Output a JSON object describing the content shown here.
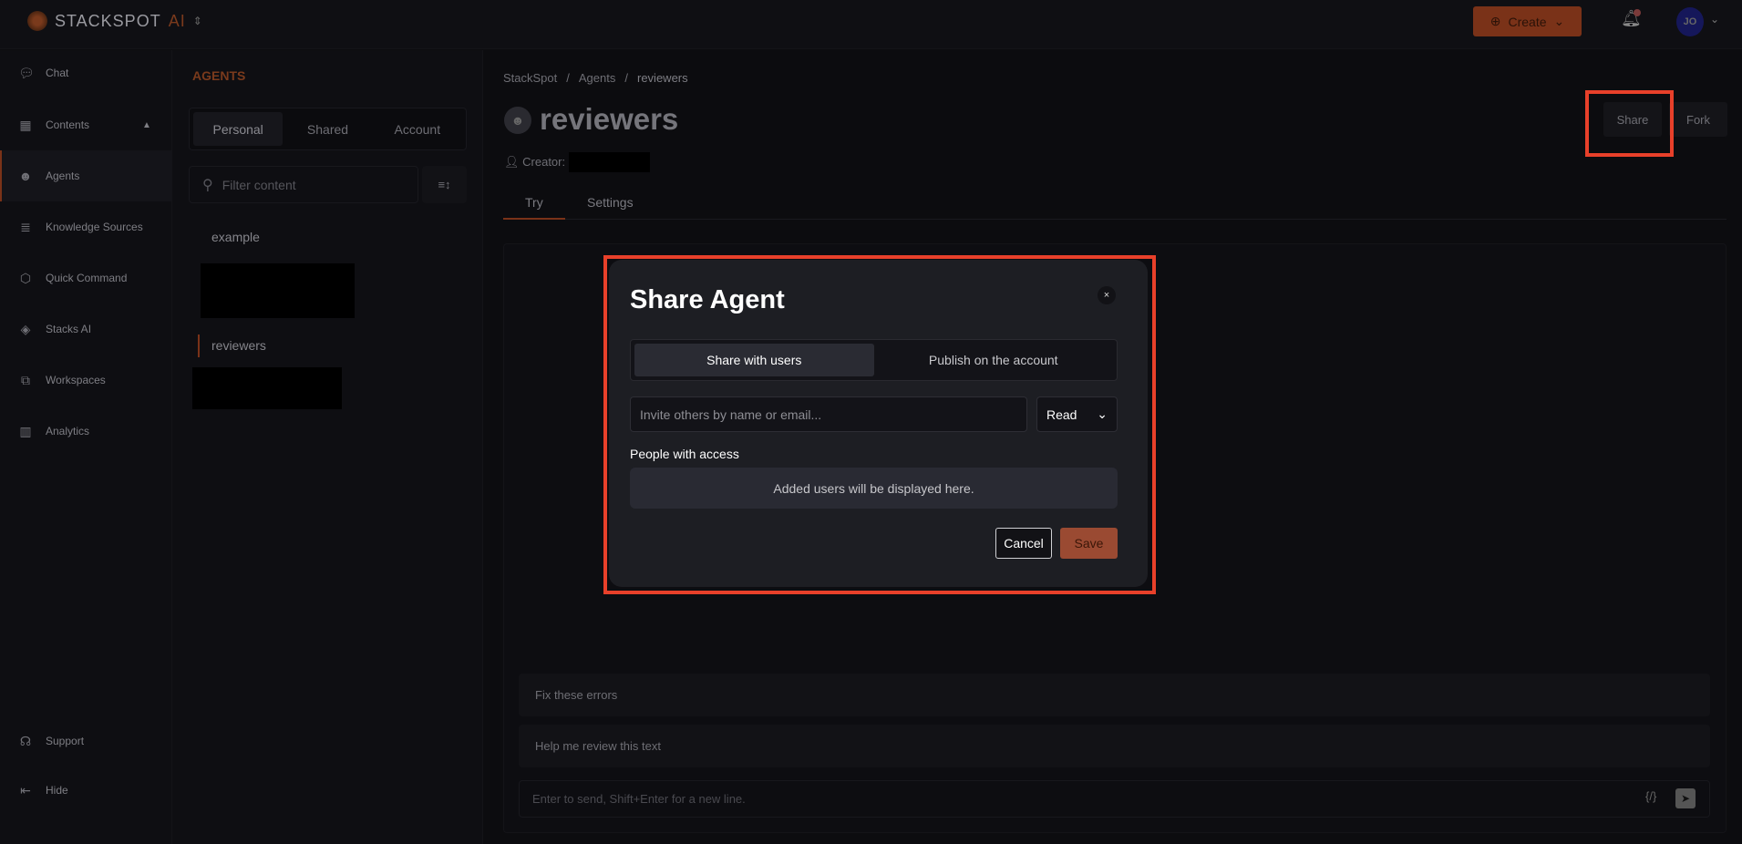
{
  "topbar": {
    "logo_text": "STACKSPOT",
    "logo_suffix": "AI",
    "create_label": "Create",
    "avatar_initials": "JO"
  },
  "sidebar": {
    "items": [
      {
        "label": "Chat",
        "icon": "chat-bubble-icon"
      },
      {
        "label": "Contents",
        "icon": "grid-icon"
      },
      {
        "label": "Agents",
        "icon": "robot-icon"
      },
      {
        "label": "Knowledge Sources",
        "icon": "database-icon"
      },
      {
        "label": "Quick Command",
        "icon": "hexagon-icon"
      },
      {
        "label": "Stacks AI",
        "icon": "layers-icon"
      },
      {
        "label": "Workspaces",
        "icon": "workspaces-icon"
      },
      {
        "label": "Analytics",
        "icon": "chart-icon"
      }
    ],
    "footer": [
      {
        "label": "Support",
        "icon": "headset-icon"
      },
      {
        "label": "Hide",
        "icon": "collapse-icon"
      }
    ]
  },
  "panel": {
    "heading": "AGENTS",
    "tabs": [
      "Personal",
      "Shared",
      "Account"
    ],
    "filter_placeholder": "Filter content",
    "items": [
      "example",
      "reviewers"
    ]
  },
  "main": {
    "breadcrumb": [
      "StackSpot",
      "Agents",
      "reviewers"
    ],
    "title": "reviewers",
    "share_label": "Share",
    "fork_label": "Fork",
    "creator_label": "Creator:",
    "tabs": [
      "Try",
      "Settings"
    ],
    "suggestions": [
      "Fix these errors",
      "Help me review this text"
    ],
    "chat_placeholder": "Enter to send, Shift+Enter for a new line."
  },
  "modal": {
    "title": "Share Agent",
    "close": "×",
    "tabs": [
      "Share with users",
      "Publish on the account"
    ],
    "invite_placeholder": "Invite others by name or email...",
    "permission": "Read",
    "people_label": "People with access",
    "empty_text": "Added users will be displayed here.",
    "cancel_label": "Cancel",
    "save_label": "Save"
  },
  "colors": {
    "accent": "#7a3218",
    "highlight": "#e8402a",
    "save": "#9a4a32"
  }
}
